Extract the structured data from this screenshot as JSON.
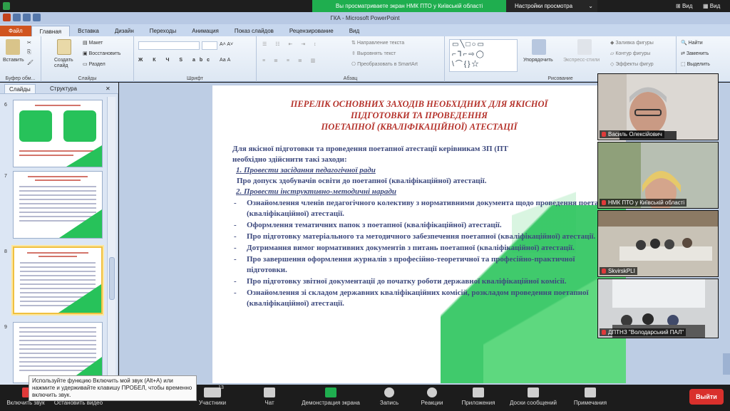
{
  "zoom_top": {
    "share_banner": "Вы просматриваете экран НМК ПТО у Київській області",
    "view_options": "Настройки просмотра",
    "view_label": "Вид",
    "view_label2": "Вид"
  },
  "ppt": {
    "title": "ГКА - Microsoft PowerPoint",
    "tabs": [
      "Файл",
      "Главная",
      "Вставка",
      "Дизайн",
      "Переходы",
      "Анимация",
      "Показ слайдов",
      "Рецензирование",
      "Вид"
    ],
    "active_tab": "Главная",
    "ribbon": {
      "paste": "Вставить",
      "clipboard_group": "Буфер обм...",
      "layout": "Макет",
      "reset": "Восстановить",
      "section": "Раздел",
      "new_slide": "Создать слайд",
      "slides_group": "Слайды",
      "font_group": "Шрифт",
      "text_direction": "Направление текста",
      "align_text": "Выровнять текст",
      "convert_smartart": "Преобразовать в SmartArt",
      "paragraph_group": "Абзац",
      "arrange": "Упорядочить",
      "quick_styles": "Экспресс-стили",
      "shape_fill": "Заливка фигуры",
      "shape_outline": "Контур фигуры",
      "shape_effects": "Эффекты фигур",
      "drawing_group": "Рисование",
      "find": "Найти",
      "replace": "Заменить",
      "select": "Выделить"
    },
    "pane_tabs": {
      "slides": "Слайды",
      "outline": "Структура"
    },
    "thumbs": [
      {
        "num": "6"
      },
      {
        "num": "7"
      },
      {
        "num": "8"
      },
      {
        "num": "9"
      }
    ],
    "slide": {
      "title_lines": [
        "ПЕРЕЛІК ОСНОВНИХ ЗАХОДІВ НЕОБХІДНИХ ДЛЯ ЯКІСНОЇ",
        "ПІДГОТОВКИ ТА ПРОВЕДЕННЯ",
        "ПОЕТАПНОЇ (КВАЛІФІКАЦІЙНОЇ) АТЕСТАЦІЇ"
      ],
      "intro1": "Для якісної підготовки та проведення поетапної атестації керівникам ЗП (ПТ",
      "intro2": "необхідно здійснити такі заходи:",
      "item1": "1. Провести засідання педагогічної ради",
      "item1_text": "Про допуск здобувачів освіти до поетапної (кваліфікаційної) атестації.",
      "item2": "2. Провести інструктивно-методичні наради",
      "bullets": [
        "Ознайомлення членів педагогічного колективу з нормативними документа щодо проведення поетапної (кваліфікаційної) атестації.",
        "Оформлення тематичних папок з поетапної (кваліфікаційної) атестації.",
        "Про підготовку матеріального та методичного забезпечення поетапної (кваліфікаційної) атестації.",
        "Дотримання вимог нормативних документів з питань поетапної (кваліфікаційної) атестації.",
        "Про завершення оформлення журналів з професійно-теоретичної та професійно-практичної підготовки.",
        "Про підготовку звітної документації до початку роботи державної кваліфікаційної комісії.",
        "Ознайомлення зі складом державних кваліфікаційних комісій, розкладом проведення поетапної (кваліфікаційної) атестації."
      ]
    }
  },
  "participants": [
    {
      "name": "Василь Олексійович"
    },
    {
      "name": "НМК ПТО у Київській області"
    },
    {
      "name": "SkvirskPLI"
    },
    {
      "name": "ДПТНЗ \"Володарський ПАЛ\""
    }
  ],
  "zoom_toolbar": {
    "audio": "Включить звук",
    "video": "Остановить видео",
    "participants": "Участники",
    "participants_count": "13",
    "chat": "Чат",
    "share": "Демонстрация экрана",
    "record": "Запись",
    "reactions": "Реакции",
    "apps": "Приложения",
    "whiteboard": "Доски сообщений",
    "notes": "Примечания",
    "leave": "Выйти",
    "tooltip": "Используйте функцию Включить мой звук (Alt+A) или нажмите и удерживайте клавишу ПРОБЕЛ, чтобы временно включить звук."
  }
}
